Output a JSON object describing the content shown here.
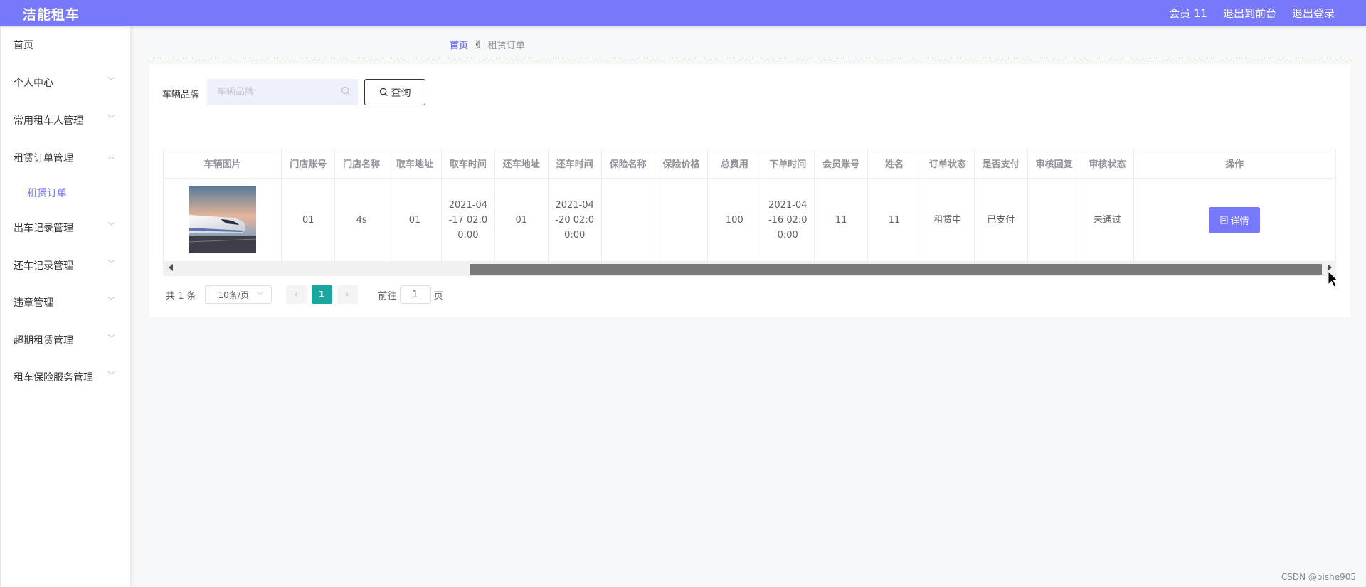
{
  "header": {
    "brand": "洁能租车",
    "user": "会员 11",
    "back_to_front": "退出到前台",
    "logout": "退出登录",
    "bg_color": "#7878fa"
  },
  "sidebar": {
    "items": [
      {
        "label": "首页",
        "expandable": false
      },
      {
        "label": "个人中心",
        "expandable": true
      },
      {
        "label": "常用租车人管理",
        "expandable": true
      },
      {
        "label": "租赁订单管理",
        "expandable": true,
        "expanded": true
      },
      {
        "label": "租赁订单",
        "sub": true
      },
      {
        "label": "出车记录管理",
        "expandable": true
      },
      {
        "label": "还车记录管理",
        "expandable": true
      },
      {
        "label": "违章管理",
        "expandable": true
      },
      {
        "label": "超期租赁管理",
        "expandable": true
      },
      {
        "label": "租车保险服务管理",
        "expandable": true
      }
    ]
  },
  "breadcrumb": {
    "home": "首页",
    "separator_icon": "hand-icon",
    "current": "租赁订单"
  },
  "search": {
    "label": "车辆品牌",
    "placeholder": "车辆品牌",
    "value": "",
    "button_label": "查询"
  },
  "table": {
    "columns": [
      "车辆图片",
      "门店账号",
      "门店名称",
      "取车地址",
      "取车时间",
      "还车地址",
      "还车时间",
      "保险名称",
      "保险价格",
      "总费用",
      "下单时间",
      "会员账号",
      "姓名",
      "订单状态",
      "是否支付",
      "审核回复",
      "审核状态",
      "操作"
    ],
    "rows": [
      {
        "image": "train-image",
        "store_account": "01",
        "store_name": "4s",
        "pickup_address": "01",
        "pickup_time": "2021-04-17 02:00:00",
        "return_address": "01",
        "return_time": "2021-04-20 02:00:00",
        "insurance_name": "",
        "insurance_price": "",
        "total_cost": "100",
        "order_time": "2021-04-16 02:00:00",
        "member_account": "11",
        "name": "11",
        "order_status": "租赁中",
        "paid": "已支付",
        "review_reply": "",
        "review_status": "未通过",
        "action_label": "详情"
      }
    ]
  },
  "pagination": {
    "total": "共 1 条",
    "page_size": "10条/页",
    "current_page": "1",
    "goto_prefix": "前往",
    "goto_value": "1",
    "goto_suffix": "页",
    "active_color": "#1aa59e"
  },
  "watermark": "CSDN @bishe905"
}
